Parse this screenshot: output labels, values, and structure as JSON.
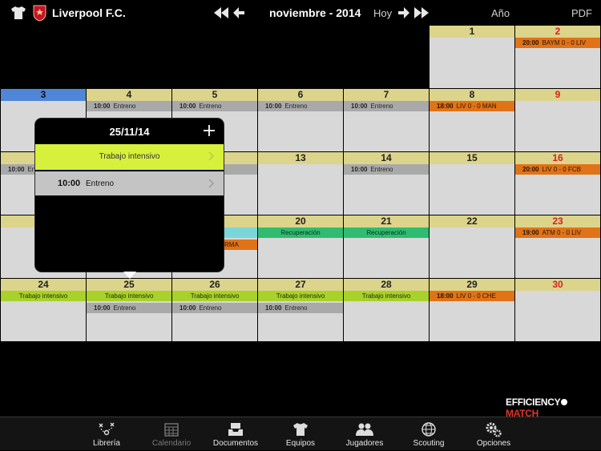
{
  "header": {
    "team_name": "Liverpool F.C.",
    "month_label": "noviembre - 2014",
    "today_label": "Hoy",
    "year_label": "Año",
    "pdf_label": "PDF"
  },
  "calendar": {
    "days": {
      "d1": "1",
      "d2": "2",
      "d3": "3",
      "d4": "4",
      "d5": "5",
      "d6": "6",
      "d7": "7",
      "d8": "8",
      "d9": "9",
      "d13": "13",
      "d14": "14",
      "d15": "15",
      "d16": "16",
      "d20": "20",
      "d21": "21",
      "d22": "22",
      "d23": "23",
      "d24": "24",
      "d25": "25",
      "d26": "26",
      "d27": "27",
      "d28": "28",
      "d29": "29",
      "d30": "30"
    },
    "events": {
      "e2": {
        "time": "20:00",
        "title": "BAYM 0 - 0 LIV"
      },
      "e4": {
        "time": "10:00",
        "title": "Entreno"
      },
      "e5": {
        "time": "10:00",
        "title": "Entreno"
      },
      "e6": {
        "time": "10:00",
        "title": "Entreno"
      },
      "e7": {
        "time": "10:00",
        "title": "Entreno"
      },
      "e8": {
        "time": "18:00",
        "title": "LIV 0 - 0 MAN"
      },
      "e10": {
        "time": "10:00",
        "title": "En"
      },
      "e14": {
        "time": "10:00",
        "title": "Entreno"
      },
      "e16": {
        "time": "20:00",
        "title": "LIV 0 - 0 FCB"
      },
      "e19": {
        "title": "RMA"
      },
      "e20": {
        "title": "Recuperación"
      },
      "e21": {
        "title": "Recuperación"
      },
      "e23": {
        "time": "19:00",
        "title": "ATM 0 - 0 LIV"
      },
      "e24": {
        "title": "Trabajo intensivo"
      },
      "e25a": {
        "title": "Trabajo intensivo"
      },
      "e25b": {
        "time": "10:00",
        "title": "Entreno"
      },
      "e26a": {
        "title": "Trabajo intensivo"
      },
      "e26b": {
        "time": "10:00",
        "title": "Entreno"
      },
      "e27a": {
        "title": "Trabajo intensivo"
      },
      "e27b": {
        "time": "10:00",
        "title": "Entreno"
      },
      "e28": {
        "title": "Trabajo intensivo"
      },
      "e29": {
        "time": "18:00",
        "title": "LIV 0 - 0 CHE"
      }
    }
  },
  "popup": {
    "date": "25/11/14",
    "row1_title": "Trabajo intensivo",
    "row2_time": "10:00",
    "row2_title": "Entreno"
  },
  "logo": {
    "part1": "EFFICIENCY",
    "part2": "MATCH"
  },
  "tabbar": {
    "items": [
      {
        "label": "Librería",
        "icon": "tactics-icon"
      },
      {
        "label": "Calendario",
        "icon": "calendar-icon"
      },
      {
        "label": "Documentos",
        "icon": "document-tray-icon"
      },
      {
        "label": "Equipos",
        "icon": "shirt-icon"
      },
      {
        "label": "Jugadores",
        "icon": "players-icon"
      },
      {
        "label": "Scouting",
        "icon": "globe-icon"
      },
      {
        "label": "Opciones",
        "icon": "gears-icon"
      }
    ]
  },
  "colors": {
    "day_header": "#dcd48a",
    "today_header": "#4f86d8",
    "training": "#a9a9a9",
    "match": "#e07317",
    "intensive": "#a8d12c",
    "recovery": "#2fbc70",
    "popup_highlight": "#d7f03c"
  }
}
